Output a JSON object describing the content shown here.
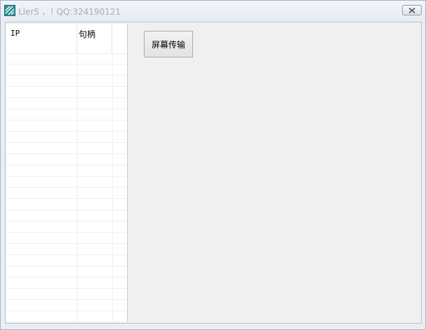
{
  "window": {
    "title": "Ll",
    "title_full": "Ller5 、! QQ:324190121",
    "close_icon": "close-icon",
    "app_icon": "app-icon"
  },
  "listview": {
    "columns": [
      {
        "label": "IP"
      },
      {
        "label": "句柄"
      }
    ]
  },
  "actions": {
    "screen_transfer_label": "屏幕传输"
  },
  "colors": {
    "title_text": "#a8aeb6",
    "window_border": "#a7b4c4",
    "client_bg": "#f0f0f0",
    "list_bg": "#ffffff"
  }
}
